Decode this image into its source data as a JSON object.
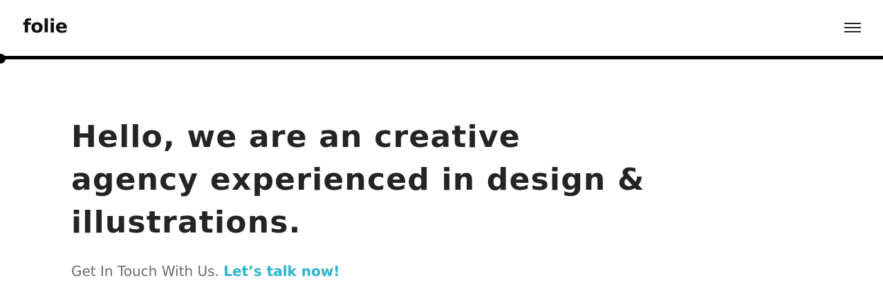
{
  "header": {
    "logo": "folie",
    "menu_icon": "hamburger-menu-icon"
  },
  "progress": {
    "value": 0
  },
  "hero": {
    "title_lines": [
      "Hello, we are an creative",
      "agency experienced in design &",
      "illustrations."
    ],
    "cta_text": "Get In Touch With Us.",
    "cta_link": "Let’s talk now!"
  },
  "colors": {
    "accent": "#2bb3cc",
    "text": "#242424",
    "muted": "#6b6b6b"
  }
}
